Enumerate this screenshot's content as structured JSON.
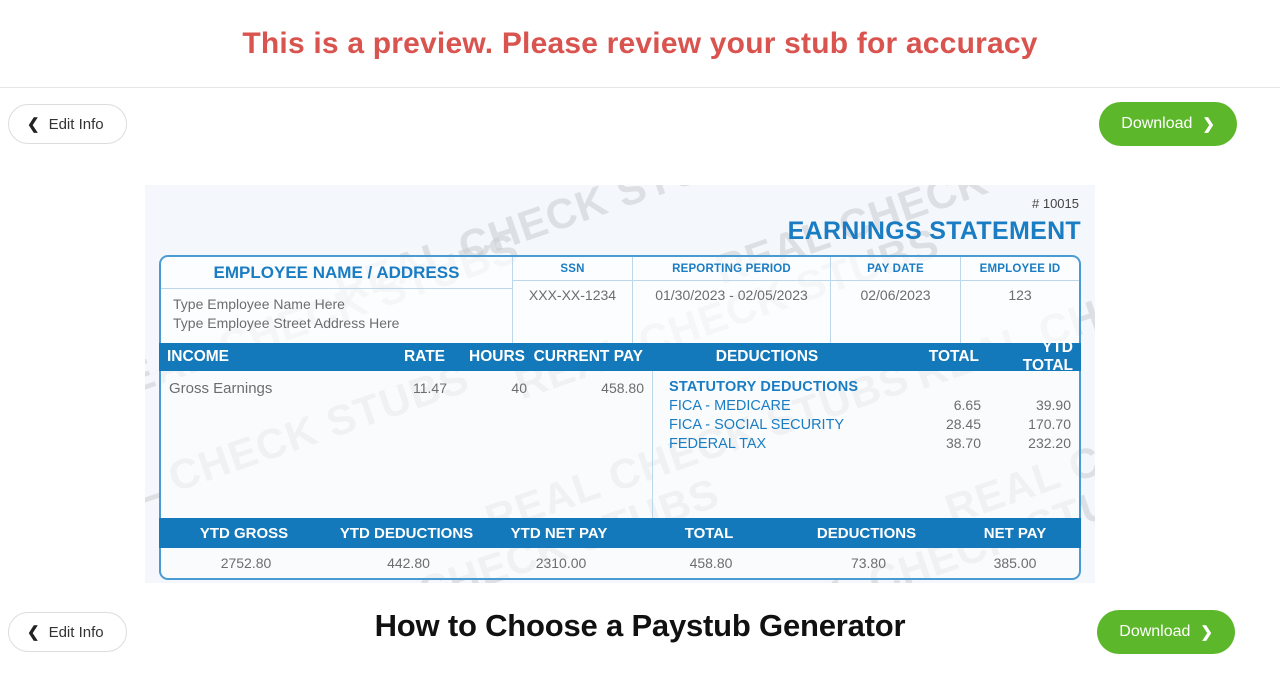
{
  "banner": {
    "message": "This is a preview. Please review your stub for accuracy",
    "color": "#d9534f"
  },
  "toolbar": {
    "edit_label": "Edit Info",
    "edit_icon": "chevron-left-icon",
    "download_label": "Download",
    "download_icon": "chevron-right-icon",
    "download_color": "#5cb82a"
  },
  "paystub": {
    "stub_number": "# 10015",
    "title": "EARNINGS STATEMENT",
    "title_color": "#1a7dc4",
    "band_color": "#1479bb",
    "watermark_text": "REAL CHECK STUBS",
    "employee": {
      "headers": {
        "name_address": "EMPLOYEE NAME / ADDRESS",
        "ssn": "SSN",
        "reporting_period": "REPORTING PERIOD",
        "pay_date": "PAY DATE",
        "employee_id": "EMPLOYEE ID"
      },
      "values": {
        "name": "Type Employee Name Here",
        "address": "Type Employee Street Address Here",
        "ssn": "XXX-XX-1234",
        "reporting_period": "01/30/2023 - 02/05/2023",
        "pay_date": "02/06/2023",
        "employee_id": "123"
      }
    },
    "earnings_headers": {
      "income": "INCOME",
      "rate": "RATE",
      "hours": "HOURS",
      "current_pay": "CURRENT PAY",
      "deductions": "DEDUCTIONS",
      "total": "TOTAL",
      "ytd_total": "YTD TOTAL"
    },
    "income_rows": [
      {
        "label": "Gross Earnings",
        "rate": "11.47",
        "hours": "40",
        "current_pay": "458.80"
      }
    ],
    "deductions_title": "STATUTORY DEDUCTIONS",
    "deduction_rows": [
      {
        "label": "FICA - MEDICARE",
        "total": "6.65",
        "ytd_total": "39.90"
      },
      {
        "label": "FICA - SOCIAL SECURITY",
        "total": "28.45",
        "ytd_total": "170.70"
      },
      {
        "label": "FEDERAL TAX",
        "total": "38.70",
        "ytd_total": "232.20"
      }
    ],
    "summary_headers": {
      "ytd_gross": "YTD GROSS",
      "ytd_deductions": "YTD DEDUCTIONS",
      "ytd_net_pay": "YTD NET PAY",
      "total": "TOTAL",
      "deductions": "DEDUCTIONS",
      "net_pay": "NET PAY"
    },
    "summary_values": {
      "ytd_gross": "2752.80",
      "ytd_deductions": "442.80",
      "ytd_net_pay": "2310.00",
      "total": "458.80",
      "deductions": "73.80",
      "net_pay": "385.00"
    }
  },
  "article": {
    "heading": "How to Choose a Paystub Generator"
  }
}
